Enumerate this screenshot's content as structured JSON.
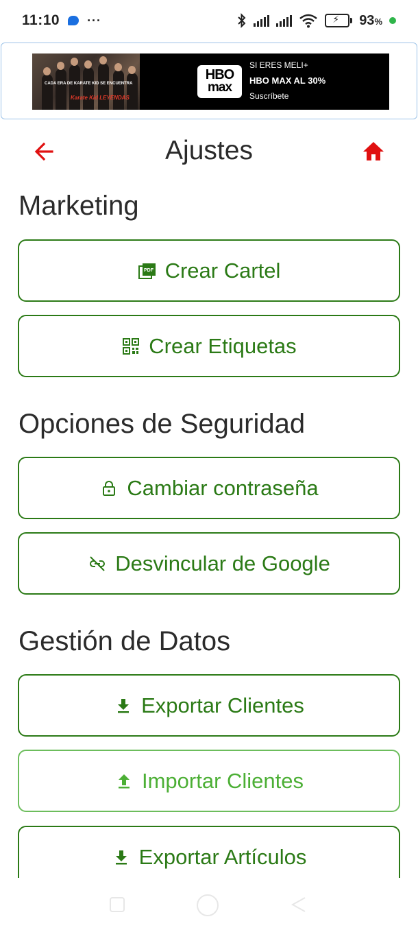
{
  "status_bar": {
    "time": "11:10",
    "dots": "···",
    "battery_percent": "93",
    "battery_unit": "%",
    "battery_level": 0.93,
    "accent_green": "#2fb54a"
  },
  "ad": {
    "tagline": "CADA ERA DE KARATE KID SE ENCUENTRA",
    "film_logo": "Karate Kid LEYENDAS",
    "brand_line1": "HBO",
    "brand_line2": "max",
    "line1": "SI ERES MELI+",
    "line2": "HBO MAX AL 30%",
    "line3": "Suscríbete"
  },
  "header": {
    "title": "Ajustes",
    "back_icon": "arrow-left-icon",
    "home_icon": "home-icon",
    "icon_color": "#e01010"
  },
  "sections": {
    "marketing": {
      "title": "Marketing",
      "create_poster": "Crear Cartel",
      "create_labels": "Crear Etiquetas"
    },
    "security": {
      "title": "Opciones de Seguridad",
      "change_password": "Cambiar contraseña",
      "unlink_google": "Desvincular de Google"
    },
    "data": {
      "title": "Gestión de Datos",
      "export_clients": "Exportar Clientes",
      "import_clients": "Importar Clientes",
      "export_articles": "Exportar Artículos"
    }
  },
  "colors": {
    "primary_green": "#2b7a16",
    "light_green": "#4caf35",
    "text_dark": "#2b2b2b"
  }
}
